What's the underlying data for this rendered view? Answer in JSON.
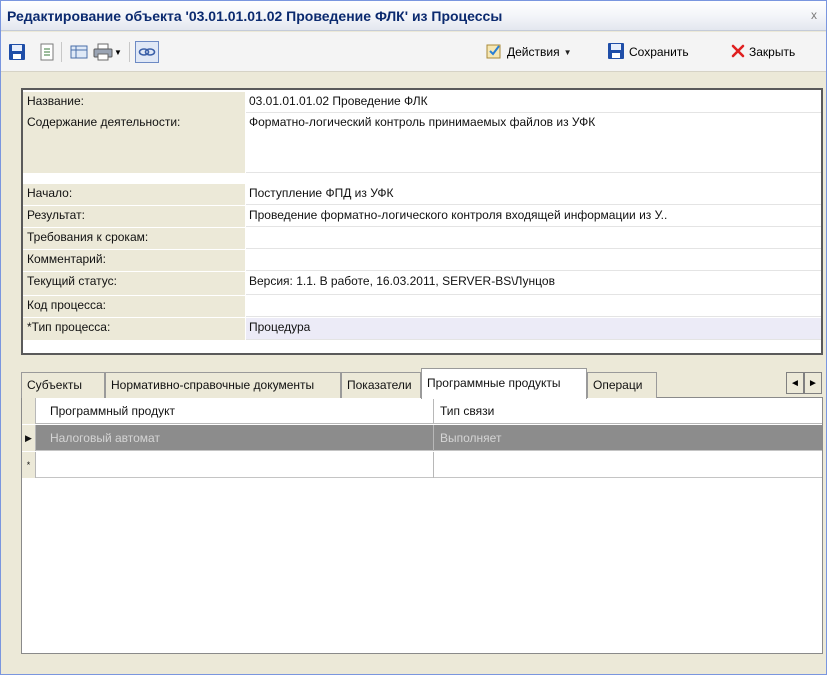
{
  "window": {
    "title": "Редактирование объекта '03.01.01.01.02 Проведение ФЛК' из Процессы",
    "close_glyph": "x"
  },
  "toolbar": {
    "icons": [
      "save-icon",
      "document-icon",
      "table-icon",
      "print-icon",
      "link-icon"
    ],
    "actions_label": "Действия",
    "save_label": "Сохранить",
    "close_label": "Закрыть"
  },
  "properties": {
    "rows": [
      {
        "label": "Название:",
        "value": "03.01.01.01.02 Проведение ФЛК"
      },
      {
        "label": "Содержание деятельности:",
        "value": "Форматно-логический контроль принимаемых файлов из УФК"
      },
      {
        "label": "Начало:",
        "value": "Поступление ФПД из УФК"
      },
      {
        "label": "Результат:",
        "value": "Проведение форматно-логического контроля входящей информации из У.."
      },
      {
        "label": "Требования к срокам:",
        "value": ""
      },
      {
        "label": "Комментарий:",
        "value": ""
      },
      {
        "label": "Текущий статус:",
        "value": "Версия: 1.1. В работе, 16.03.2011, SERVER-BS\\Лунцов"
      },
      {
        "label": "Код процесса:",
        "value": ""
      },
      {
        "label": "*Тип процесса:",
        "value": "Процедура"
      }
    ]
  },
  "tabs": [
    {
      "label": "Субъекты"
    },
    {
      "label": "Нормативно-справочные документы"
    },
    {
      "label": "Показатели"
    },
    {
      "label": "Программные продукты"
    },
    {
      "label": "Операци"
    }
  ],
  "tab_scroll": {
    "left": "◄",
    "right": "►"
  },
  "grid": {
    "columns": [
      "Программный продукт",
      "Тип связи"
    ],
    "rows": [
      {
        "indicator": "▶",
        "product": "Налоговый автомат",
        "link_type": "Выполняет"
      },
      {
        "indicator": "*",
        "product": "",
        "link_type": ""
      }
    ]
  },
  "colors": {
    "title_text": "#0b2a6f",
    "selected_row": "#8c8c8c",
    "label_background": "#ece9d8",
    "highlight_row": "#ecebf7",
    "close_icon": "#e02020",
    "save_icon": "#1f4ea8"
  }
}
